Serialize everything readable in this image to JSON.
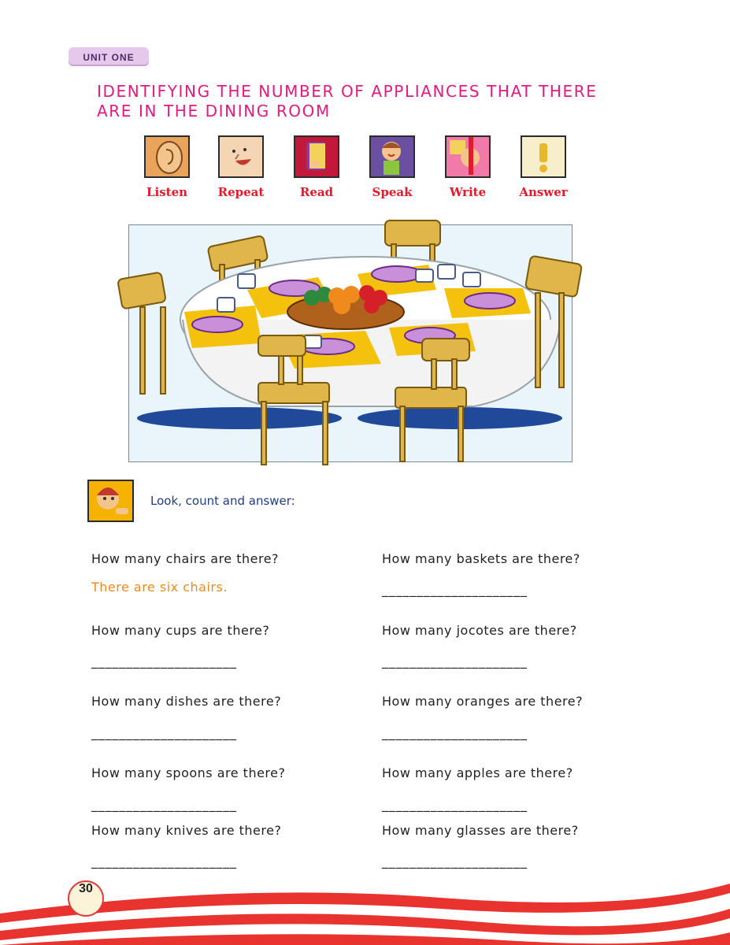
{
  "unit_label": "UNIT ONE",
  "title_line1": "IDENTIFYING THE NUMBER OF APPLIANCES THAT THERE",
  "title_line2": "ARE IN THE DINING ROOM",
  "skills": [
    {
      "label": "Listen",
      "icon": "ear-icon",
      "color": "#e9a35a"
    },
    {
      "label": "Repeat",
      "icon": "talking-face-icon",
      "color": "#f4d6b4"
    },
    {
      "label": "Read",
      "icon": "book-icon",
      "color": "#c2193a"
    },
    {
      "label": "Speak",
      "icon": "girl-speaking-icon",
      "color": "#6b4fa0"
    },
    {
      "label": "Write",
      "icon": "pencil-hand-icon",
      "color": "#f07ba8"
    },
    {
      "label": "Answer",
      "icon": "exclamation-icon",
      "color": "#f7eecb"
    }
  ],
  "instruction": "Look, count and answer:",
  "questions_left": [
    {
      "q": "How many chairs are there?",
      "a": "There are six chairs."
    },
    {
      "q": "How many cups are there?",
      "a": "_____________________"
    },
    {
      "q": "How many dishes are there?",
      "a": "_____________________"
    },
    {
      "q": "How many spoons are there?",
      "a": "_____________________"
    },
    {
      "q": "How many knives are there?",
      "a": "_____________________"
    }
  ],
  "questions_right": [
    {
      "q": "How many baskets are there?",
      "a": "_____________________"
    },
    {
      "q": "How many jocotes are there?",
      "a": "_____________________"
    },
    {
      "q": "How many oranges are there?",
      "a": "_____________________"
    },
    {
      "q": "How many apples are there?",
      "a": "_____________________"
    },
    {
      "q": "How many glasses are there?",
      "a": "_____________________"
    }
  ],
  "page_number": "30",
  "colors": {
    "title": "#e5197f",
    "skill_label": "#e5192a",
    "answer": "#f08a1c",
    "instruction": "#1f3c8c",
    "wave": "#e8332f"
  }
}
